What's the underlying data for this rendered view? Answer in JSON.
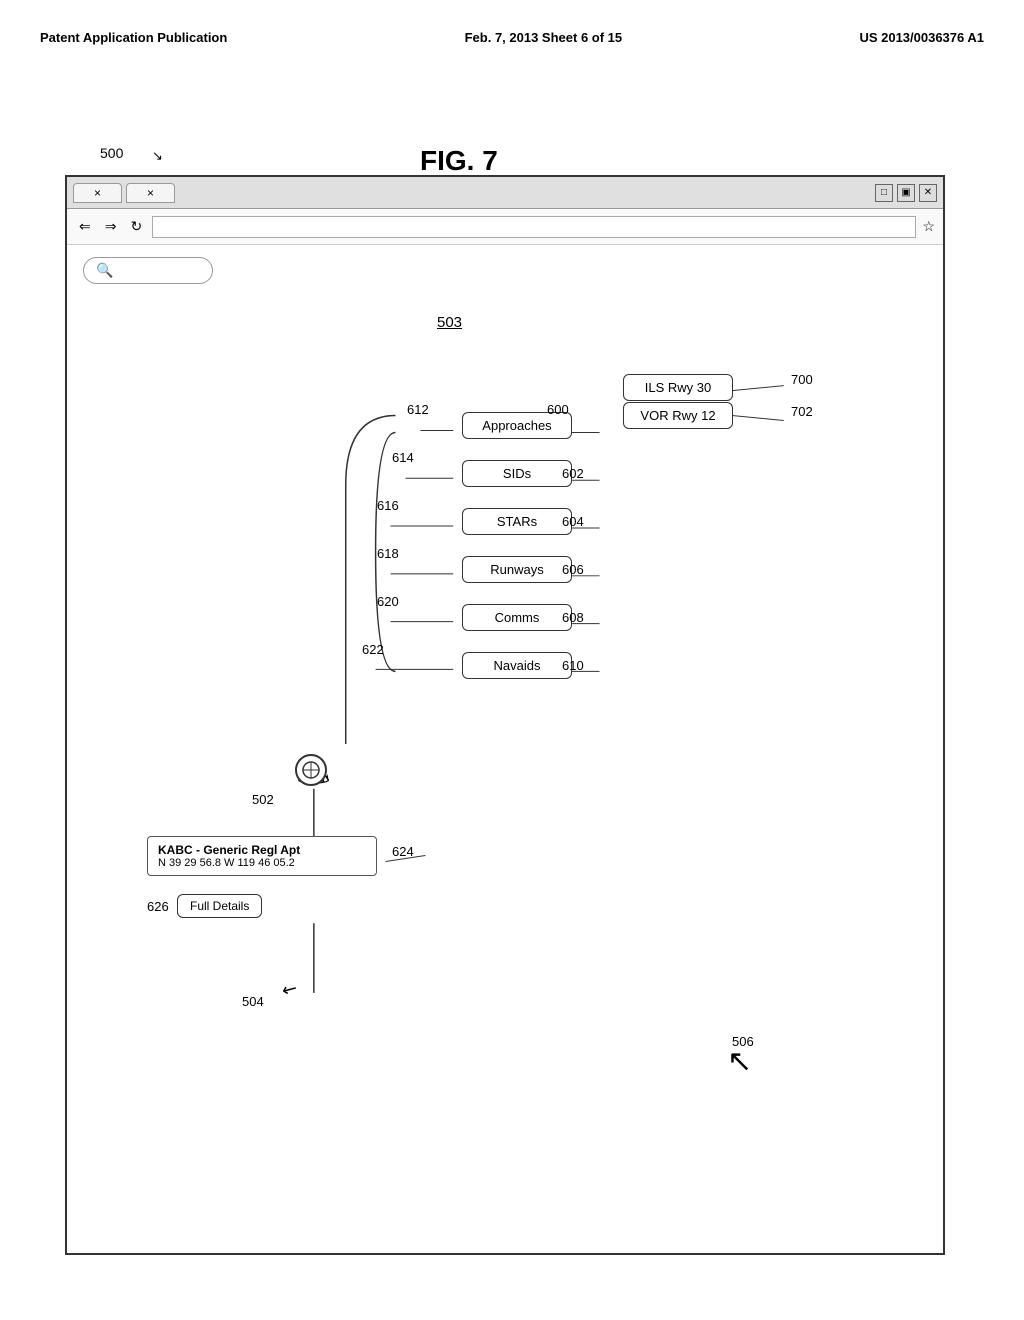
{
  "header": {
    "left": "Patent Application Publication",
    "center": "Feb. 7, 2013   Sheet 6 of 15",
    "right": "US 2013/0036376 A1"
  },
  "figure": {
    "label": "FIG. 7",
    "ref_main": "500",
    "ref_arrow": "↘"
  },
  "browser": {
    "tab1_close": "×",
    "tab2_close": "×",
    "win_min": "□",
    "win_max": "▣",
    "win_close": "✕",
    "nav_back": "⇐",
    "nav_forward": "⇒",
    "nav_refresh": "↻",
    "nav_star": "☆",
    "search_icon": "🔍"
  },
  "diagram": {
    "ref503": "503",
    "menu_items": [
      {
        "id": "approaches",
        "label": "Approaches",
        "ref": "612",
        "ref_sub": "600"
      },
      {
        "id": "sids",
        "label": "SIDs",
        "ref": "614",
        "ref_sub": "602"
      },
      {
        "id": "stars",
        "label": "STARs",
        "ref": "616",
        "ref_sub": "604"
      },
      {
        "id": "runways",
        "label": "Runways",
        "ref": "618",
        "ref_sub": "606"
      },
      {
        "id": "comms",
        "label": "Comms",
        "ref": "620",
        "ref_sub": "608"
      },
      {
        "id": "navaids",
        "label": "Navaids",
        "ref": "622",
        "ref_sub": "610"
      }
    ],
    "approach_items": [
      {
        "id": "ils",
        "label": "ILS Rwy 30",
        "ref": "700"
      },
      {
        "id": "vor",
        "label": "VOR Rwy 12",
        "ref": "702"
      }
    ],
    "info_box": {
      "ref": "624",
      "title": "KABC - Generic Regl Apt",
      "coords": "N 39 29 56.8 W 119 46 05.2"
    },
    "full_details_btn": {
      "label": "Full Details",
      "ref": "626"
    },
    "ref_502": "502",
    "ref_504": "504",
    "ref_506": "506"
  }
}
